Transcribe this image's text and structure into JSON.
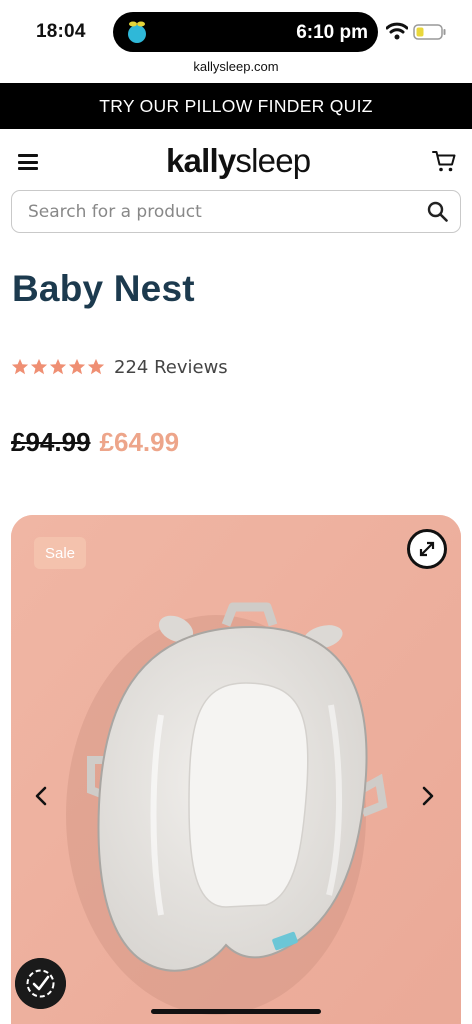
{
  "status_bar": {
    "time": "18:04",
    "island_time": "6:10 pm",
    "url": "kallysleep.com"
  },
  "promo": {
    "text": "TRY OUR PILLOW FINDER QUIZ"
  },
  "header": {
    "logo_bold": "kally",
    "logo_light": "sleep",
    "icons": [
      "menu-icon",
      "cart-icon"
    ]
  },
  "search": {
    "placeholder": "Search for a product"
  },
  "product": {
    "title": "Baby Nest",
    "rating": 5,
    "reviews": "224 Reviews",
    "old_price": "£94.99",
    "sale_price": "£64.99"
  },
  "gallery": {
    "badge": "Sale",
    "icons": [
      "expand-icon",
      "chevron-left-icon",
      "chevron-right-icon",
      "accessibility-icon"
    ]
  },
  "colors": {
    "title": "#1c3a4e",
    "sale_price": "#eda58a",
    "stars": "#ef8f73",
    "gallery_bg": "#eeb3a2",
    "badge_bg": "#f4c2ad",
    "promo_bg": "#000000"
  }
}
